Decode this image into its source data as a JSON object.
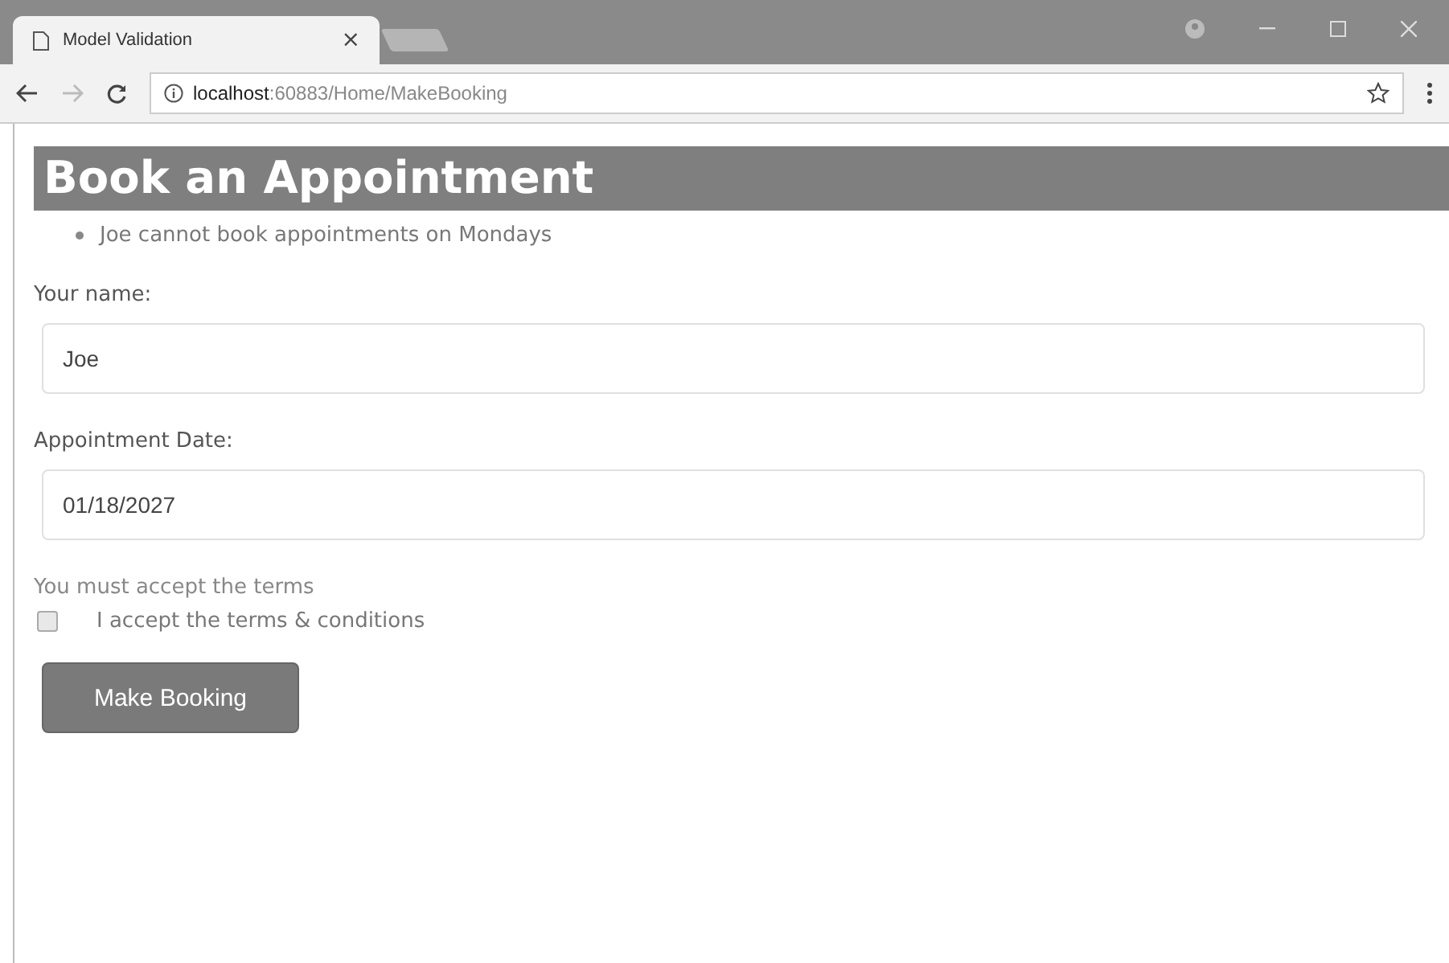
{
  "browser": {
    "tab": {
      "title": "Model Validation",
      "close": "×"
    },
    "address": {
      "host": "localhost",
      "path": ":60883/Home/MakeBooking"
    }
  },
  "page": {
    "heading": "Book an Appointment",
    "errors": [
      "Joe cannot book appointments on Mondays"
    ],
    "fields": [
      {
        "label": "Your name:",
        "value": "Joe"
      },
      {
        "label": "Appointment Date:",
        "value": "01/18/2027"
      }
    ],
    "terms_error": "You must accept the terms",
    "terms": {
      "label": "I accept the terms & conditions",
      "checked": false
    },
    "submit": "Make Booking"
  }
}
